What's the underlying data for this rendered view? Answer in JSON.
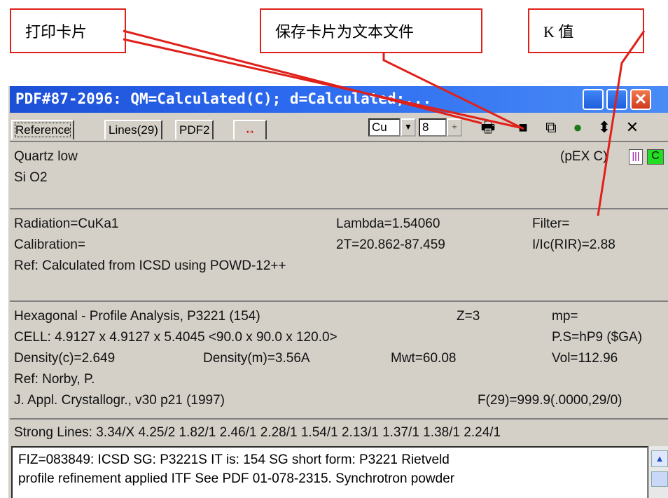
{
  "callouts": {
    "print": "打印卡片",
    "save_text": "保存卡片为文本文件",
    "k_value": "K 值"
  },
  "window": {
    "title": "PDF#87-2096: QM=Calculated(C); d=Calculated;...",
    "tabs": [
      {
        "label": "Reference"
      },
      {
        "label": "Lines(29)"
      },
      {
        "label": "PDF2"
      }
    ],
    "radiation_select": "Cu",
    "digits": "8"
  },
  "header": {
    "name": "Quartz low",
    "formula": "Si O2",
    "tags": "(pEX C)",
    "tag_c": "C"
  },
  "experiment": {
    "radiation": "Radiation=CuKa1",
    "lambda": "Lambda=1.54060",
    "filter": "Filter=",
    "calibration": "Calibration=",
    "two_theta": "2T=20.862-87.459",
    "rir": "I/Ic(RIR)=2.88",
    "ref": "Ref: Calculated from ICSD using POWD-12++"
  },
  "crystal": {
    "system": "Hexagonal - Profile Analysis,  P3221 (154)",
    "z": "Z=3",
    "mp": "mp=",
    "cell": "CELL: 4.9127 x 4.9127 x 5.4045 <90.0 x 90.0 x 120.0>",
    "ps": "P.S=hP9 ($GA)",
    "density_c": "Density(c)=2.649",
    "density_m": "Density(m)=3.56A",
    "mwt": "Mwt=60.08",
    "vol": "Vol=112.96",
    "ref_author": "Ref: Norby, P.",
    "journal": "J. Appl. Crystallogr., v30 p21 (1997)",
    "fom": "F(29)=999.9(.0000,29/0)"
  },
  "strong_lines": "Strong Lines: 3.34/X 4.25/2 1.82/1 2.46/1 2.28/1 1.54/1 2.13/1 1.37/1 1.38/1 2.24/1",
  "comments": {
    "line1": "FIZ=083849: ICSD SG: P3221S      IT  is: 154 SG short form: P3221 Rietveld",
    "line2": "profile refinement applied ITF See PDF 01-078-2315. Synchrotron powder"
  },
  "colors": {
    "callout_border": "#e0201a",
    "titlebar": "#1c4fd6"
  }
}
